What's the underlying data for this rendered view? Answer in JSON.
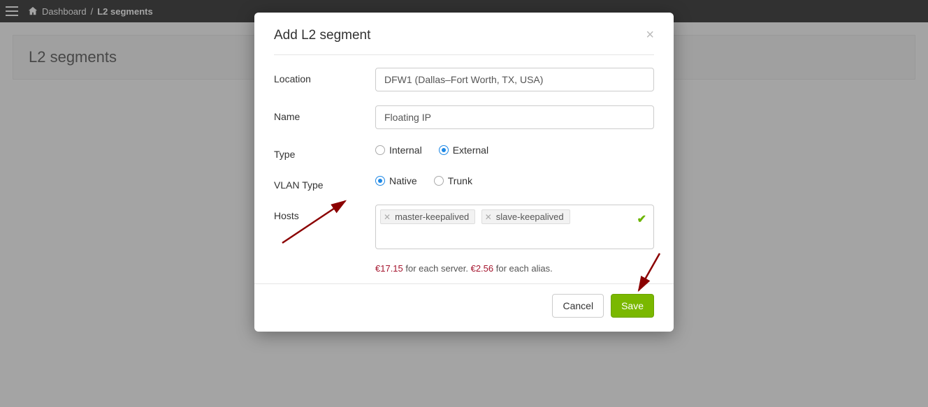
{
  "topbar": {
    "breadcrumb_home": "Dashboard",
    "breadcrumb_sep": "/",
    "breadcrumb_current": "L2 segments"
  },
  "page": {
    "title": "L2 segments"
  },
  "modal": {
    "title": "Add L2 segment",
    "labels": {
      "location": "Location",
      "name": "Name",
      "type": "Type",
      "vlan_type": "VLAN Type",
      "hosts": "Hosts"
    },
    "values": {
      "location": "DFW1 (Dallas–Fort Worth, TX, USA)",
      "name": "Floating IP"
    },
    "type_options": {
      "internal": "Internal",
      "external": "External",
      "selected": "external"
    },
    "vlan_options": {
      "native": "Native",
      "trunk": "Trunk",
      "selected": "native"
    },
    "hosts": {
      "tag1": "master-keepalived",
      "tag2": "slave-keepalived"
    },
    "pricing": {
      "server_amount": "€17.15",
      "server_text": " for each server. ",
      "alias_amount": "€2.56",
      "alias_text": " for each alias."
    },
    "buttons": {
      "cancel": "Cancel",
      "save": "Save"
    }
  }
}
